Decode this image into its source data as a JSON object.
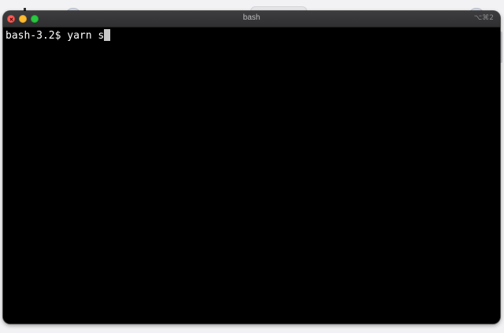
{
  "window": {
    "title": "bash",
    "shortcut": "⌥⌘2"
  },
  "terminal": {
    "lines": [
      {
        "prompt": "bash-3.2$",
        "command": "yarn s"
      }
    ],
    "cursor": "block"
  },
  "colors": {
    "terminal_background": "#000000",
    "text": "#ffffff",
    "close": "#ff5f57",
    "minimize": "#febc2e",
    "maximize": "#28c840"
  }
}
